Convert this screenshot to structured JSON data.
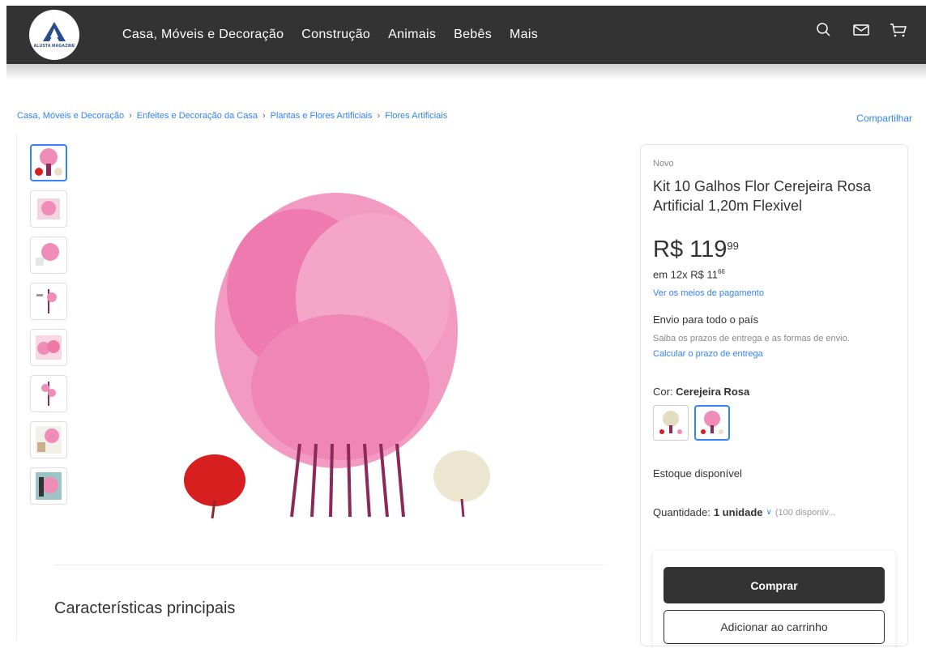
{
  "header": {
    "logo_text": "ALUSTA MAGAZINE",
    "nav": [
      "Casa, Móveis e Decoração",
      "Construção",
      "Animais",
      "Bebês",
      "Mais"
    ]
  },
  "breadcrumb": [
    "Casa, Móveis e Decoração",
    "Enfeites e Decoração da Casa",
    "Plantas e Flores Artificiais",
    "Flores Artificiais"
  ],
  "share_label": "Compartilhar",
  "product": {
    "condition": "Novo",
    "title": "Kit 10 Galhos Flor Cerejeira Rosa Artificial 1,20m Flexivel",
    "price_main": "R$ 119",
    "price_cents": "99",
    "installments_prefix": "em 12x R$ 11",
    "installments_cents": "66",
    "payment_link": "Ver os meios de pagamento",
    "shipping_title": "Envio para todo o país",
    "shipping_info": "Saiba os prazos de entrega e as formas de envio.",
    "shipping_link": "Calcular o prazo de entrega",
    "color_label": "Cor: ",
    "color_value": "Cerejeira Rosa",
    "stock": "Estoque disponível",
    "qty_label": "Quantidade: ",
    "qty_value": "1 unidade",
    "qty_avail": "(100 disponív...",
    "buy_label": "Comprar",
    "cart_label": "Adicionar ao carrinho"
  },
  "features_title": "Características principais",
  "colors": {
    "accent": "#3483fa",
    "header": "#333333",
    "pink": "#f08cb8",
    "red": "#d81f1f"
  }
}
